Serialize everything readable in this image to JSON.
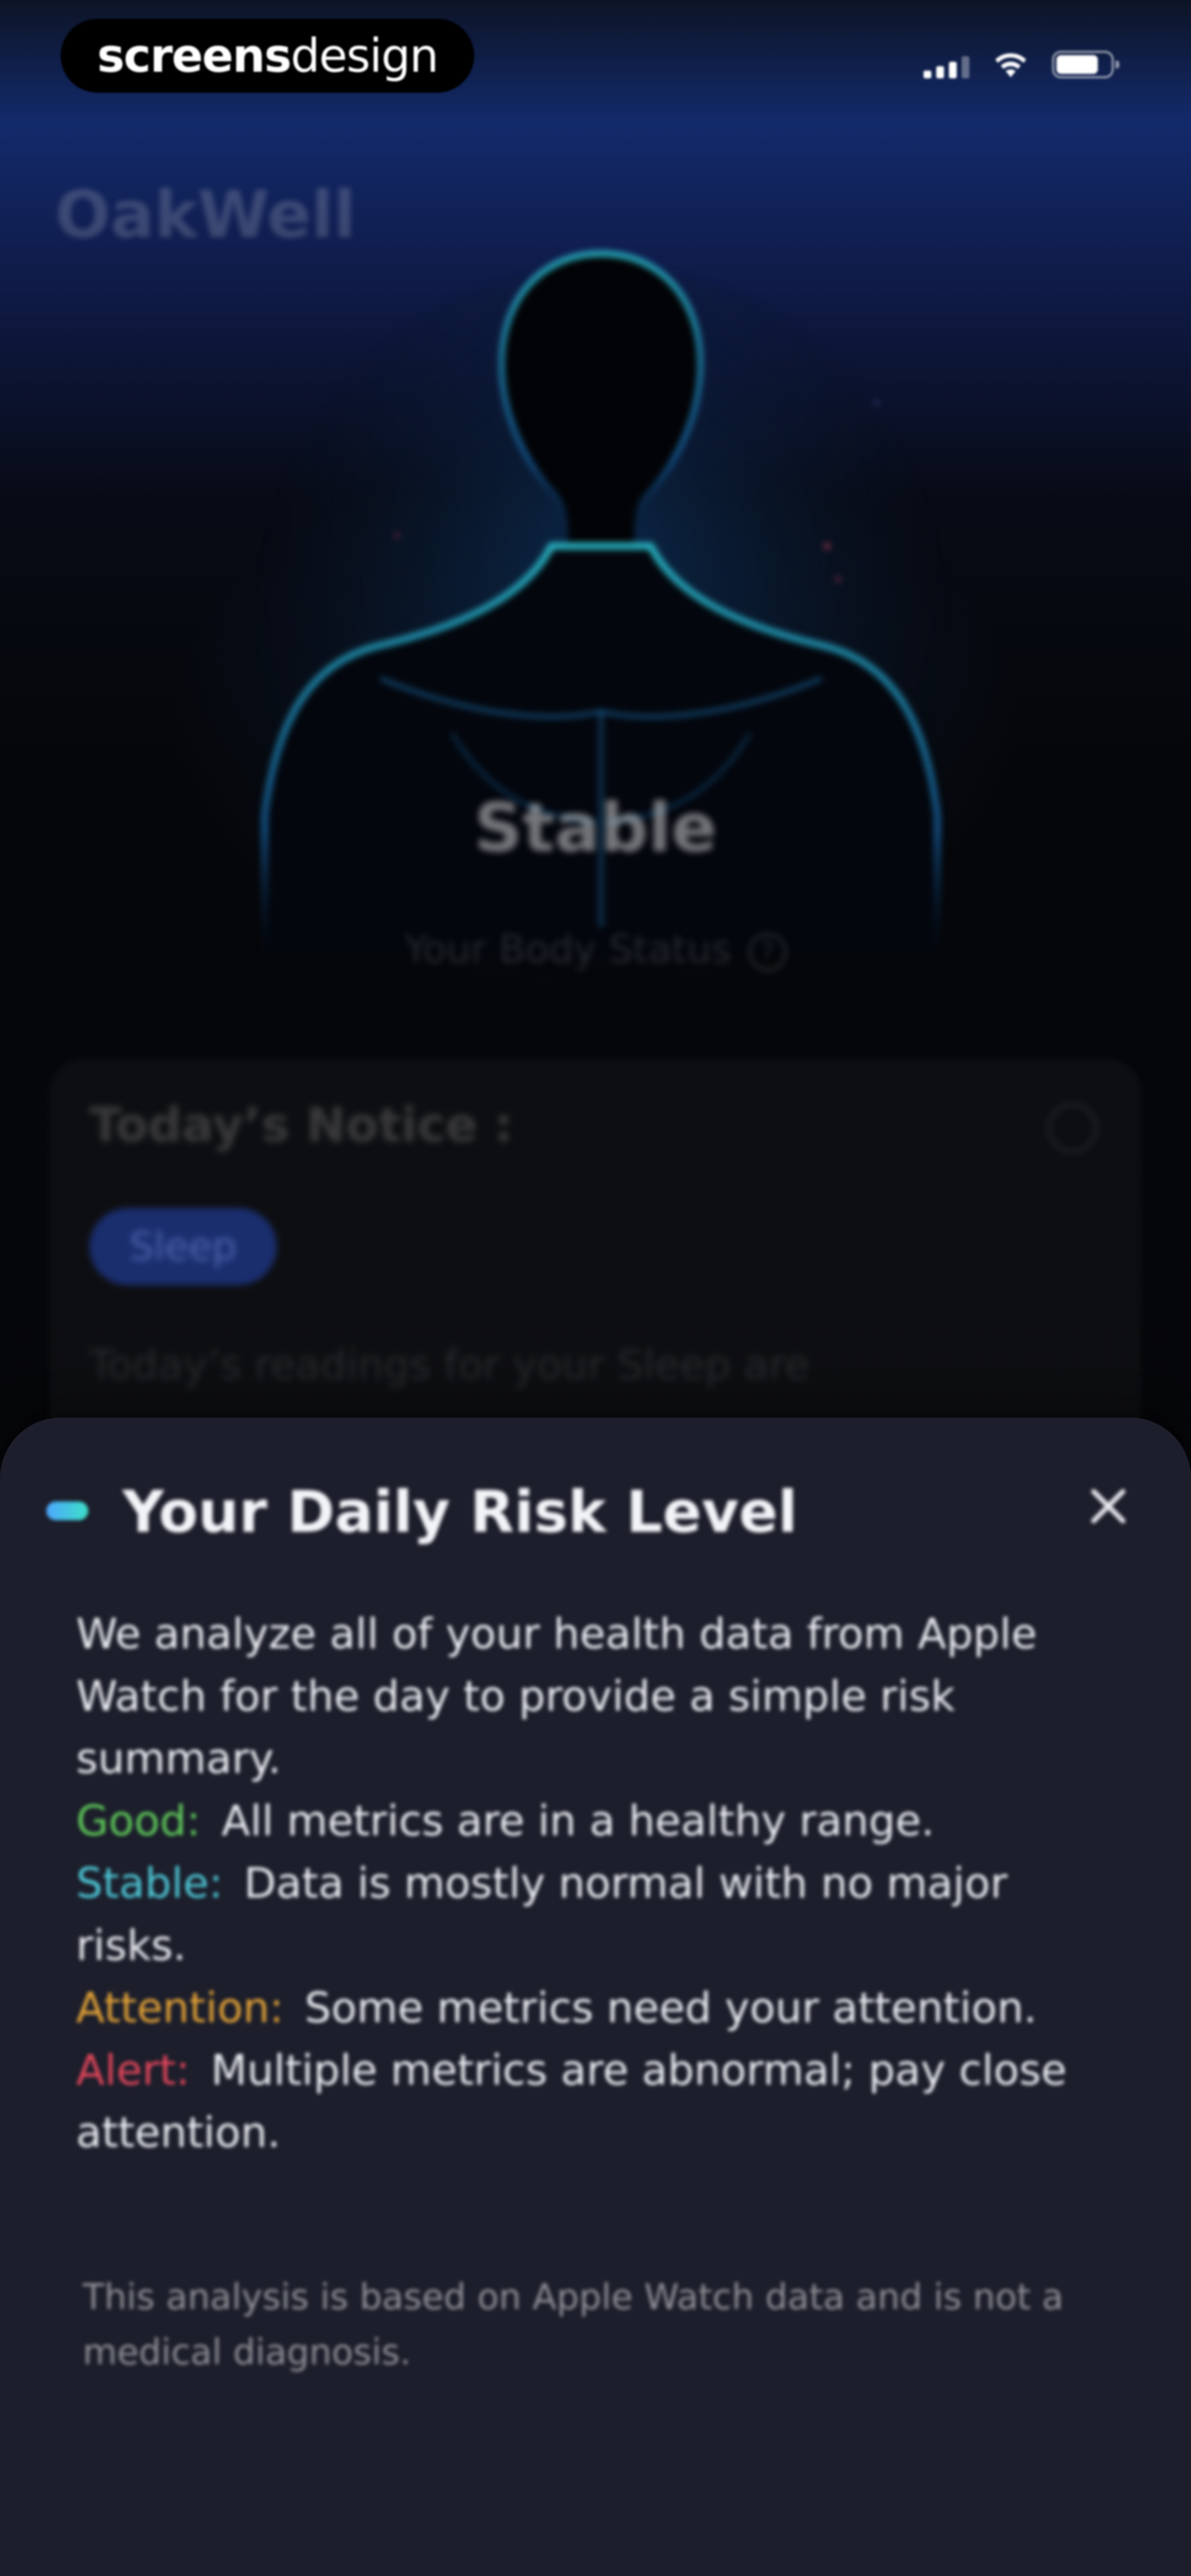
{
  "status_bar": {
    "watermark_bold": "screens",
    "watermark_light": "design",
    "icons": [
      "cellular-signal-icon",
      "wifi-icon",
      "battery-icon"
    ]
  },
  "app": {
    "title": "OakWell"
  },
  "hero": {
    "status": "Stable",
    "caption": "Your Body Status",
    "help_glyph": "?"
  },
  "notice": {
    "title": "Today’s Notice :",
    "chip": "Sleep",
    "text": "Today’s readings for your Sleep are"
  },
  "sheet": {
    "title": "Your Daily Risk Level",
    "intro": "We analyze all of your health data from Apple Watch for the day to provide a simple risk summary.",
    "levels": [
      {
        "label": "Good:",
        "text": "All metrics are in a healthy range.",
        "color": "#5fc85a"
      },
      {
        "label": "Stable:",
        "text": "Data is mostly normal with no major risks.",
        "color": "#4ec7d6"
      },
      {
        "label": "Attention:",
        "text": "Some metrics need your attention.",
        "color": "#e3a236"
      },
      {
        "label": "Alert:",
        "text": "Multiple metrics are abnormal; pay close attention.",
        "color": "#e0465a"
      }
    ],
    "disclaimer": "This analysis is based on Apple Watch data and is not a medical diagnosis."
  },
  "colors": {
    "sheet_background": "#1c1e2b",
    "accent_gradient": [
      "#4da8ff",
      "#3de0c8"
    ]
  }
}
